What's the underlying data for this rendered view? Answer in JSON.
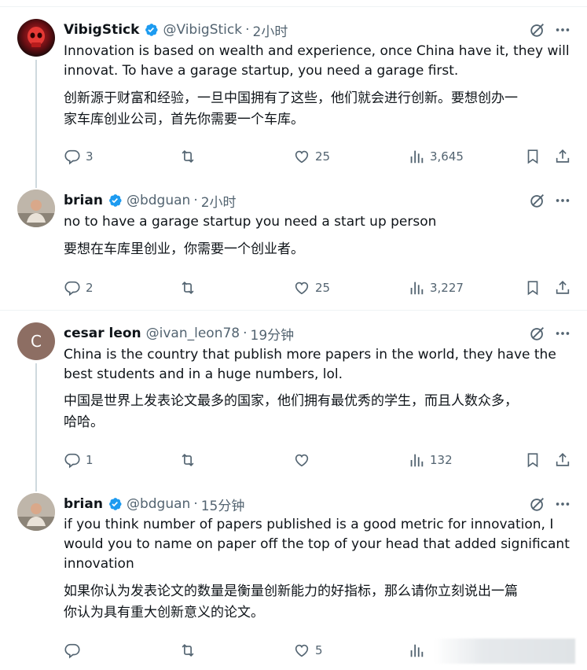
{
  "tweets": [
    {
      "name": "VibigStick",
      "handle": "@VibigStick",
      "time": "2小时",
      "text_en_1": "Innovation is based on wealth and experience, once China have it, they will",
      "text_en_2": "innovat. To have a garage startup, you need a garage first.",
      "text_zh_1": "创新源于财富和经验，一旦中国拥有了这些，他们就会进行创新。要想创办一",
      "text_zh_2": "家车库创业公司，首先你需要一个车库。",
      "replies": "3",
      "retweets": "",
      "likes": "25",
      "views": "3,645",
      "avatar_icon": "red-skull-avatar"
    },
    {
      "name": "brian",
      "handle": "@bdguan",
      "time": "2小时",
      "text_en_1": "no to have a garage startup you need a start up person",
      "text_zh_1": "要想在车库里创业，你需要一个创业者。",
      "replies": "2",
      "retweets": "",
      "likes": "25",
      "views": "3,227",
      "avatar_icon": "photo-avatar"
    },
    {
      "name": "cesar leon",
      "handle": "@ivan_leon78",
      "time": "19分钟",
      "avatar_letter": "C",
      "text_en_1": "China is the country that publish more papers in the world, they have the",
      "text_en_2": "best students and in a huge numbers, lol.",
      "text_zh_1": "中国是世界上发表论文最多的国家，他们拥有最优秀的学生，而且人数众多，",
      "text_zh_2": "哈哈。",
      "replies": "1",
      "retweets": "",
      "likes": "",
      "views": "132"
    },
    {
      "name": "brian",
      "handle": "@bdguan",
      "time": "15分钟",
      "text_en_1": "if you think number of papers published is a good metric for innovation, I",
      "text_en_2": "would you to name on paper off the top of your head that added significant",
      "text_en_3": "innovation",
      "text_zh_1": "如果你认为发表论文的数量是衡量创新能力的好指标，那么请你立刻说出一篇",
      "text_zh_2": "你认为具有重大创新意义的论文。",
      "replies": "",
      "retweets": "",
      "likes": "5",
      "views": ""
    }
  ],
  "colors": {
    "text": "#0f1419",
    "secondary": "#536471",
    "verified": "#1d9bf0",
    "thread_line": "#cfd9de",
    "divider": "#eff3f4",
    "cesar_avatar_bg": "#8d6e63"
  }
}
